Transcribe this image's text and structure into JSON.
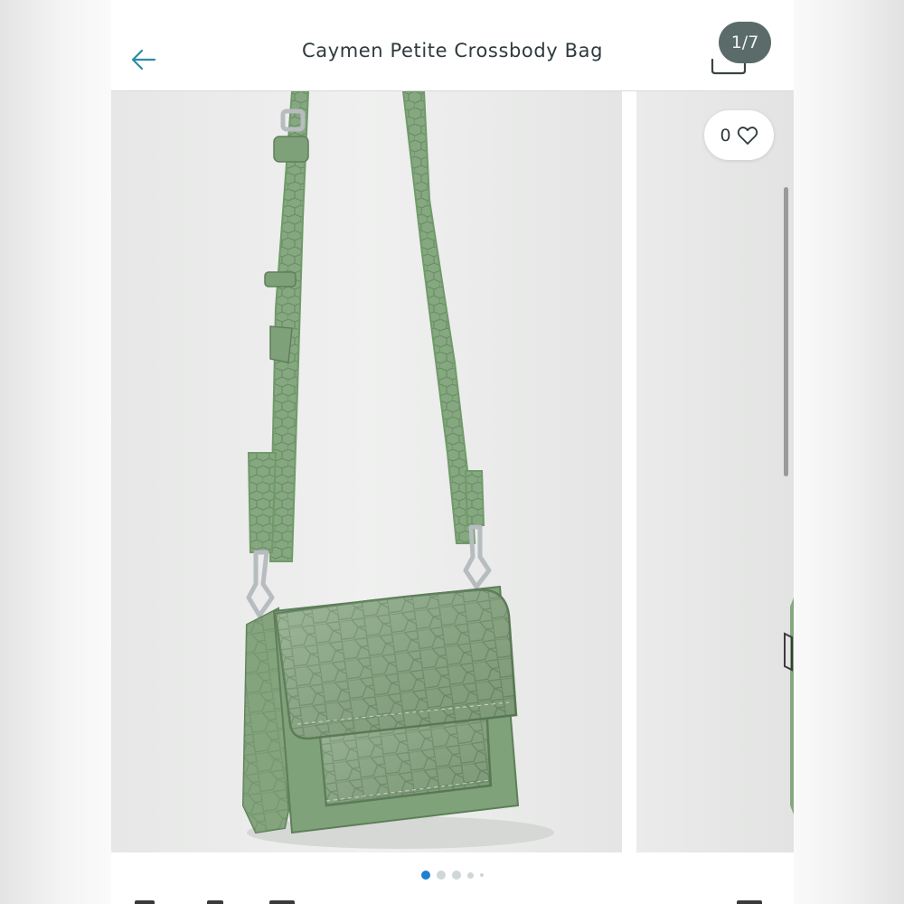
{
  "header": {
    "back_icon": "arrow-left-icon",
    "title": "Caymen Petite Crossbody Bag",
    "bag_icon": "shopping-bag-icon",
    "image_counter": "1/7"
  },
  "gallery": {
    "like_count": "0",
    "like_icon": "heart-outline-icon",
    "slides": [
      "green-croc-crossbody-bag-photo",
      "next-photo-preview"
    ],
    "dots": {
      "count": 5,
      "active_index": 0
    }
  },
  "colors": {
    "accent_blue": "#1f7fd0",
    "badge_gray": "#5b6b6a",
    "bag_green": "#8cae85",
    "text_dark": "#2f3a3d"
  }
}
